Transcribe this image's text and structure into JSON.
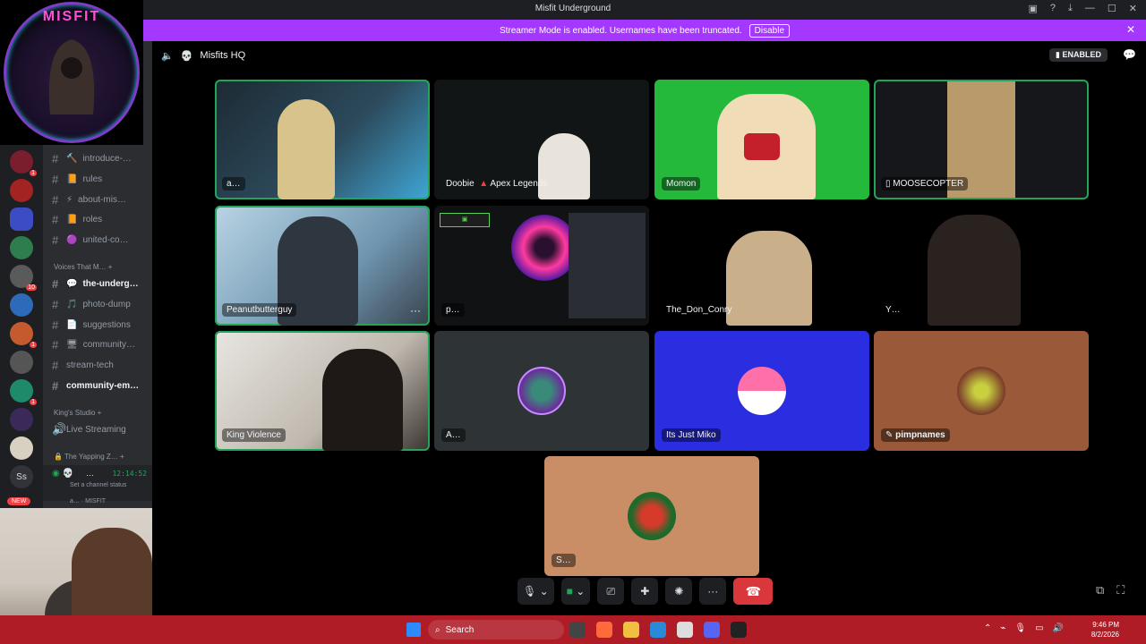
{
  "titlebar": {
    "title": "Misfit Underground"
  },
  "banner": {
    "message": "Streamer Mode is enabled. Usernames have been truncated.",
    "disable_label": "Disable"
  },
  "logo": {
    "text": "MISFIT"
  },
  "header": {
    "channel_name": "Misfits HQ",
    "enabled_label": "ENABLED"
  },
  "channels": [
    {
      "label": "introduce-…"
    },
    {
      "label": "rules"
    },
    {
      "label": "about-mis…"
    },
    {
      "label": "roles"
    },
    {
      "label": "united-co…"
    },
    {
      "label": "Voices That M…"
    },
    {
      "label": "the-underg…"
    },
    {
      "label": "photo-dump"
    },
    {
      "label": "suggestions"
    },
    {
      "label": "community…"
    },
    {
      "label": "stream-tech"
    },
    {
      "label": "community-em…"
    },
    {
      "label": "King's Studio"
    },
    {
      "label": "Live Streaming"
    },
    {
      "label": "The Yapping Z…"
    }
  ],
  "user_panel": {
    "name": "…",
    "time": "12:14:52",
    "status": "Set a channel status",
    "sub": "a… · MISFIT"
  },
  "new_tag": "NEW",
  "server_initials": "Ss",
  "tiles": [
    {
      "name": "a…"
    },
    {
      "name": "Doobie",
      "game": "Apex Legends"
    },
    {
      "name": "Momon"
    },
    {
      "name": "MOOSECOPTER"
    },
    {
      "name": "Peanutbutterguy"
    },
    {
      "name": "p…"
    },
    {
      "name": "The_Don_Conry"
    },
    {
      "name": "Y…"
    },
    {
      "name": "King Violence"
    },
    {
      "name": "A…"
    },
    {
      "name": "Its Just Miko"
    },
    {
      "name": "pimpnames"
    },
    {
      "name": "S…"
    }
  ],
  "taskbar": {
    "search_placeholder": "Search",
    "time": "9:46 PM",
    "date": "8/2/2026"
  },
  "colors": {
    "accent_banner": "#a438ff",
    "speaking": "#23a559",
    "hangup": "#da373c",
    "taskbar": "#b01c26"
  }
}
